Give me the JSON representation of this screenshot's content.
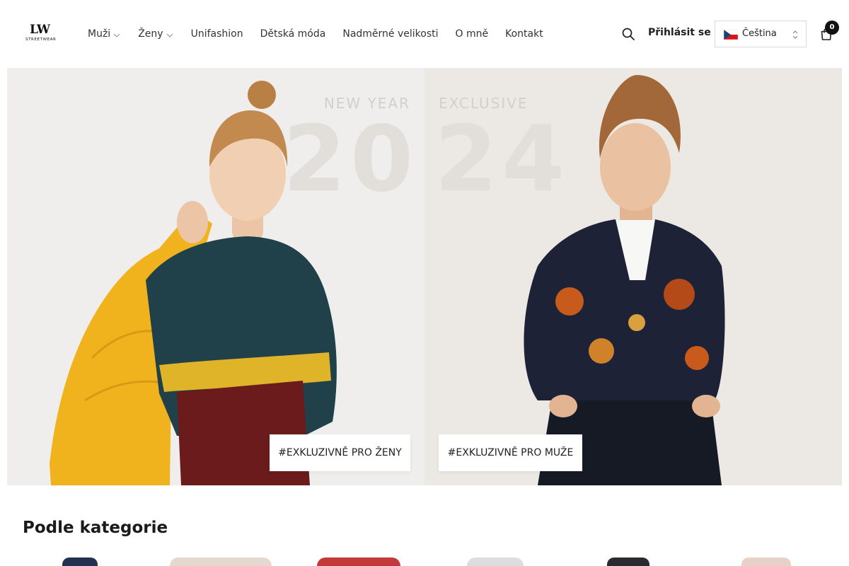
{
  "logo": {
    "mark": "LW",
    "sub": "STREETWEAR"
  },
  "nav": {
    "items": [
      {
        "label": "Muži",
        "has_dropdown": true
      },
      {
        "label": "Ženy",
        "has_dropdown": true
      },
      {
        "label": "Unifashion",
        "has_dropdown": false
      },
      {
        "label": "Dětská móda",
        "has_dropdown": false
      },
      {
        "label": "Nadměrné velikosti",
        "has_dropdown": false
      },
      {
        "label": "O mně",
        "has_dropdown": false
      },
      {
        "label": "Kontakt",
        "has_dropdown": false
      }
    ]
  },
  "header": {
    "search_icon": "search-icon",
    "login_label": "Přihlásit se",
    "language": {
      "label": "Čeština",
      "flag": "czech-flag-icon"
    },
    "cart": {
      "icon": "shopping-bag-icon",
      "count": "0"
    }
  },
  "hero": {
    "left": {
      "tag": "NEW YEAR",
      "digits": "20",
      "button_label": "#EXKLUZIVNĚ PRO ŽENY"
    },
    "right": {
      "tag": "EXCLUSIVE",
      "digits": "24",
      "button_label": "#EXKLUZIVNĚ PRO MUŽE"
    }
  },
  "categories": {
    "title": "Podle kategorie"
  },
  "colors": {
    "accent": "#111111",
    "hero_left_bg": "#efeeec",
    "hero_right_bg": "#ece8e4",
    "hero_overlay_text": "#e2dfdb"
  }
}
